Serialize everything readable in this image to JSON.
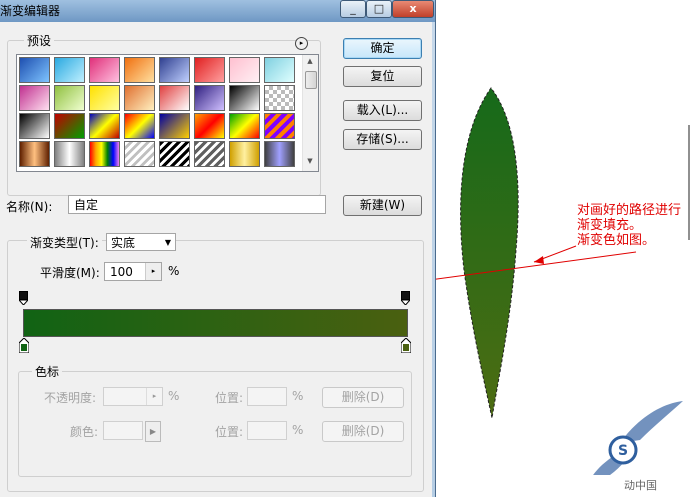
{
  "window": {
    "title": "渐变编辑器",
    "controls": [
      "_",
      "□",
      "x"
    ]
  },
  "presets": {
    "label": "预设",
    "menu_icon": "circle-arrow-icon"
  },
  "buttons": {
    "ok": "确定",
    "reset": "复位",
    "load": "载入(L)...",
    "save": "存储(S)...",
    "new": "新建(W)"
  },
  "name": {
    "label": "名称(N):",
    "value": "自定"
  },
  "gradient_type": {
    "label": "渐变类型(T):",
    "value": "实底"
  },
  "smoothness": {
    "label": "平滑度(M):",
    "value": "100",
    "unit": "%"
  },
  "gradient": {
    "start_color": "#116314",
    "end_color": "#4a6010"
  },
  "stops": {
    "group_label": "色标",
    "opacity_label": "不透明度:",
    "opacity_unit": "%",
    "position_label_1": "位置:",
    "position_unit_1": "%",
    "delete_label_1": "删除(D)",
    "color_label": "颜色:",
    "position_label_2": "位置:",
    "position_unit_2": "%",
    "delete_label_2": "删除(D)"
  },
  "annotation": {
    "line1": "对画好的路径进行",
    "line2": "渐变填充。",
    "line3": "渐变色如图。",
    "color": "#e00000"
  },
  "watermark": {
    "text": "动中国"
  }
}
